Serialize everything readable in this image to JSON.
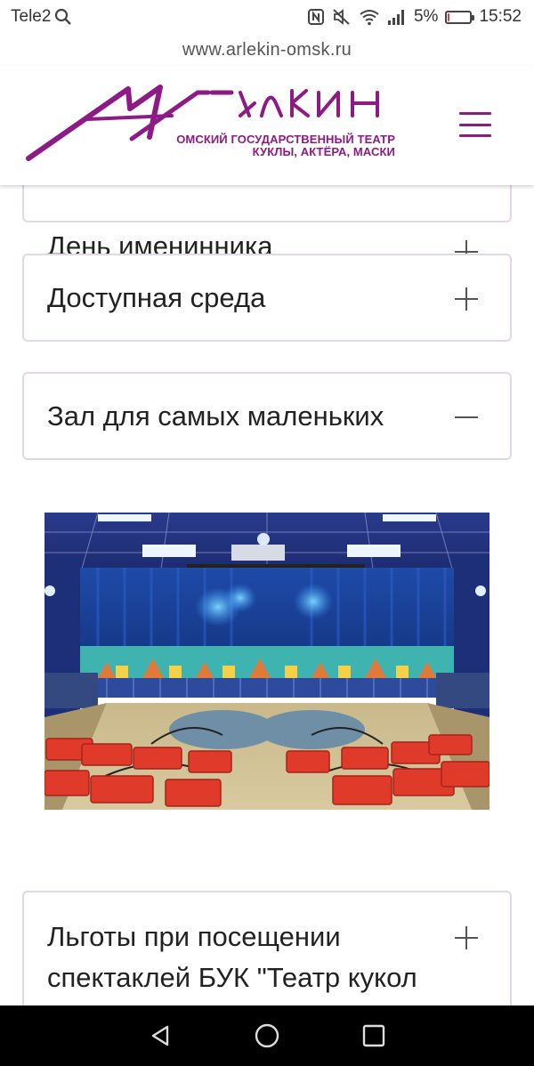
{
  "status_bar": {
    "carrier": "Tele2",
    "battery_percent": "5%",
    "battery_level": 0.05,
    "time": "15:52",
    "icons": [
      "search-icon",
      "nfc-icon",
      "mute-icon",
      "wifi-icon",
      "signal-icon",
      "battery-icon"
    ]
  },
  "browser": {
    "url": "www.arlekin-omsk.ru"
  },
  "header": {
    "logo_text": "Арлекин",
    "logo_subtitle_line1": "ОМСКИЙ ГОСУДАРСТВЕННЫЙ ТЕАТР",
    "logo_subtitle_line2": "КУКЛЫ, АКТЁРА, МАСКИ",
    "menu_icon": "hamburger-menu-icon"
  },
  "accordion": [
    {
      "title": "День именинника",
      "state": "collapsed",
      "toggle": "+"
    },
    {
      "title": "Доступная среда",
      "state": "collapsed",
      "toggle": "+"
    },
    {
      "title": "Зал для самых маленьких",
      "state": "expanded",
      "toggle": "−"
    },
    {
      "title_line1": "Льготы при посещении",
      "title_line2": "спектаклей БУК \"Театр кукол",
      "state": "collapsed",
      "toggle": "+"
    }
  ],
  "colors": {
    "brand": "#8e1a86",
    "border": "#e6d6ea",
    "text": "#222222",
    "nav_bar": "#000000"
  },
  "nav_bar": {
    "buttons": [
      "back-icon",
      "home-icon",
      "recents-icon"
    ]
  }
}
